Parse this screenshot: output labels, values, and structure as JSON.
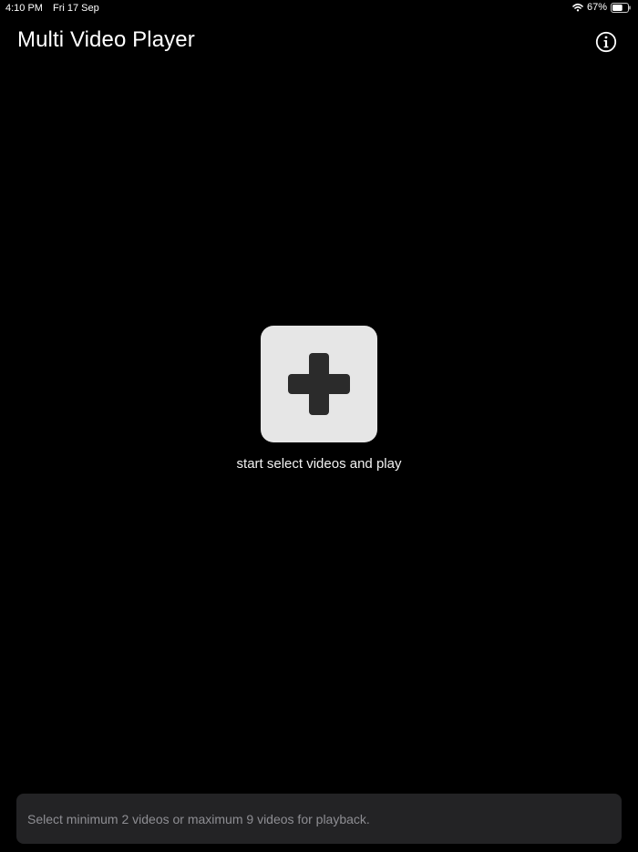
{
  "status_bar": {
    "time": "4:10 PM",
    "date": "Fri 17 Sep",
    "battery_percent_label": "67%",
    "battery_level": 0.67
  },
  "header": {
    "title": "Multi Video Player",
    "info_icon": "info-circle-icon"
  },
  "main": {
    "add_icon": "plus-icon",
    "add_label": "start select videos and play"
  },
  "footer": {
    "hint": "Select minimum 2 videos or maximum 9 videos for playback."
  },
  "colors": {
    "background": "#000000",
    "tile": "#e6e6e6",
    "plus": "#2b2b2b",
    "hint_bar": "#232325",
    "hint_text": "#8e8e93"
  }
}
